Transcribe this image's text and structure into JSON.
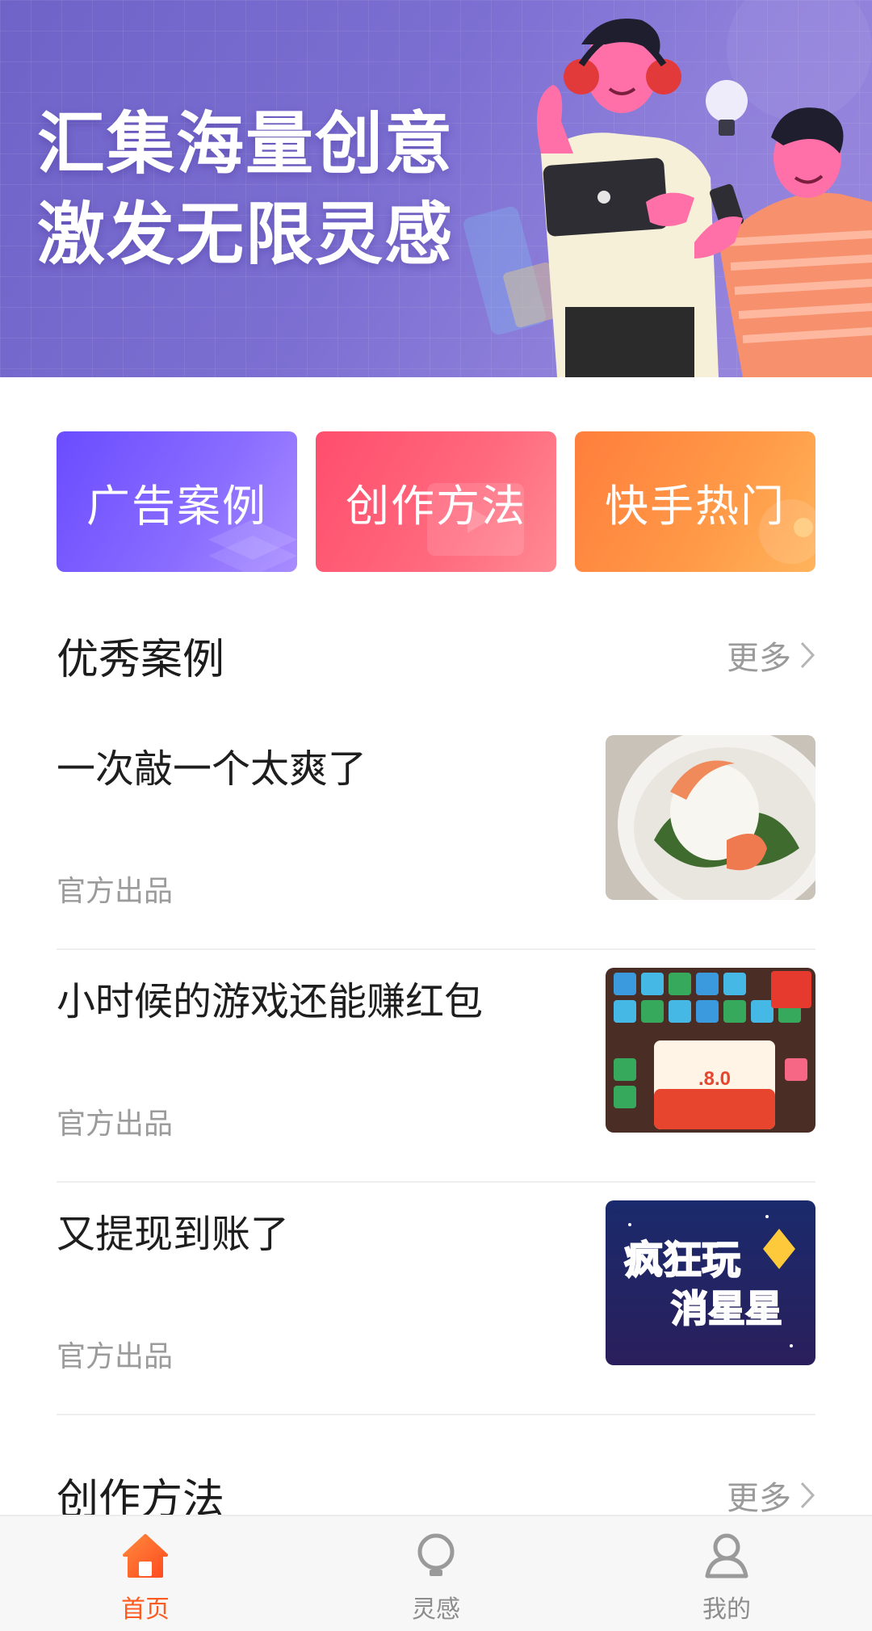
{
  "banner": {
    "slogan_line1": "汇集海量创意",
    "slogan_line2": "激发无限灵感"
  },
  "categories": [
    {
      "label": "广告案例"
    },
    {
      "label": "创作方法"
    },
    {
      "label": "快手热门"
    }
  ],
  "excellent_cases": {
    "title": "优秀案例",
    "more_label": "更多",
    "items": [
      {
        "title": "一次敲一个太爽了",
        "source": "官方出品"
      },
      {
        "title": "小时候的游戏还能赚红包",
        "source": "官方出品",
        "thumb_text": ".8.0"
      },
      {
        "title": "又提现到账了",
        "source": "官方出品",
        "thumb_text_1": "疯狂玩",
        "thumb_text_2": "消星星"
      }
    ]
  },
  "creation_methods": {
    "title": "创作方法",
    "more_label": "更多"
  },
  "bottom_nav": {
    "items": [
      {
        "label": "首页",
        "icon": "home-icon",
        "active": true
      },
      {
        "label": "灵感",
        "icon": "lightbulb-icon",
        "active": false
      },
      {
        "label": "我的",
        "icon": "person-icon",
        "active": false
      }
    ]
  },
  "colors": {
    "accent": "#ff5a1f",
    "ads_button": "#7a5cff",
    "craft_button": "#ff5a72",
    "hot_button": "#ff8c42"
  }
}
